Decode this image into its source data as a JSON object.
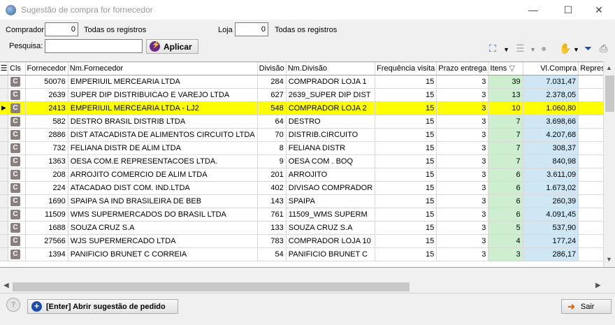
{
  "window": {
    "title": "Sugestão de compra for fornecedor",
    "minimize": "—",
    "maximize": "☐",
    "close": "✕"
  },
  "filters": {
    "comprador_label": "Comprador",
    "comprador_value": "0",
    "comprador_desc": "Todas os registros",
    "loja_label": "Loja",
    "loja_value": "0",
    "loja_desc": "Todas os registros",
    "pesquisa_label": "Pesquisa:",
    "pesquisa_value": "",
    "aplicar_label": "Aplicar"
  },
  "toolbar": {
    "icons": [
      "org-chart-icon",
      "list-icon",
      "disk-icon",
      "dropper-icon",
      "filter-icon",
      "print-icon"
    ]
  },
  "table": {
    "columns": [
      "Cls",
      "Fornecedor",
      "Nm.Fornecedor",
      "Divisão",
      "Nm.Divisão",
      "Frequência visita",
      "Prazo entrega",
      "Itens",
      "Vl.Compra",
      "Represe"
    ],
    "rows": [
      {
        "cls": "C",
        "fornecedor": "50076",
        "nome": "EMPERIUIL MERCEARIA LTDA",
        "divisao": "284",
        "nm_divisao": "COMPRADOR LOJA 1",
        "freq": "15",
        "prazo": "3",
        "itens": "39",
        "valor": "7.031,47",
        "selected": false
      },
      {
        "cls": "C",
        "fornecedor": "2639",
        "nome": "SUPER DIP DISTRIBUICAO E VAREJO LTDA",
        "divisao": "627",
        "nm_divisao": "2639_SUPER DIP DIST",
        "freq": "15",
        "prazo": "3",
        "itens": "13",
        "valor": "2.378,05",
        "selected": false
      },
      {
        "cls": "C",
        "fornecedor": "2413",
        "nome": "EMPERIUIL MERCEARIA LTDA - LJ2",
        "divisao": "548",
        "nm_divisao": "COMPRADOR LOJA 2",
        "freq": "15",
        "prazo": "3",
        "itens": "10",
        "valor": "1.060,80",
        "selected": true
      },
      {
        "cls": "C",
        "fornecedor": "582",
        "nome": "DESTRO BRASIL DISTRIB LTDA",
        "divisao": "64",
        "nm_divisao": "DESTRO",
        "freq": "15",
        "prazo": "3",
        "itens": "7",
        "valor": "3.698,66",
        "selected": false
      },
      {
        "cls": "C",
        "fornecedor": "2886",
        "nome": "DIST ATACADISTA DE ALIMENTOS CIRCUITO LTDA",
        "divisao": "70",
        "nm_divisao": "DISTRIB.CIRCUITO",
        "freq": "15",
        "prazo": "3",
        "itens": "7",
        "valor": "4.207,68",
        "selected": false
      },
      {
        "cls": "C",
        "fornecedor": "732",
        "nome": "FELIANA DISTR DE ALIM LTDA",
        "divisao": "8",
        "nm_divisao": "FELIANA DISTR",
        "freq": "15",
        "prazo": "3",
        "itens": "7",
        "valor": "308,37",
        "selected": false
      },
      {
        "cls": "C",
        "fornecedor": "1363",
        "nome": "OESA COM.E REPRESENTACOES LTDA.",
        "divisao": "9",
        "nm_divisao": "OESA COM . BOQ",
        "freq": "15",
        "prazo": "3",
        "itens": "7",
        "valor": "840,98",
        "selected": false
      },
      {
        "cls": "C",
        "fornecedor": "208",
        "nome": "ARROJITO COMERCIO DE ALIM LTDA",
        "divisao": "201",
        "nm_divisao": "ARROJITO",
        "freq": "15",
        "prazo": "3",
        "itens": "6",
        "valor": "3.611,09",
        "selected": false
      },
      {
        "cls": "C",
        "fornecedor": "224",
        "nome": "ATACADAO DIST COM. IND.LTDA",
        "divisao": "402",
        "nm_divisao": "DIVISAO COMPRADOR",
        "freq": "15",
        "prazo": "3",
        "itens": "6",
        "valor": "1.673,02",
        "selected": false
      },
      {
        "cls": "C",
        "fornecedor": "1690",
        "nome": "SPAIPA SA IND BRASILEIRA DE BEB",
        "divisao": "143",
        "nm_divisao": "SPAIPA",
        "freq": "15",
        "prazo": "3",
        "itens": "6",
        "valor": "260,39",
        "selected": false
      },
      {
        "cls": "C",
        "fornecedor": "11509",
        "nome": "WMS SUPERMERCADOS DO BRASIL LTDA",
        "divisao": "761",
        "nm_divisao": "11509_WMS SUPERM",
        "freq": "15",
        "prazo": "3",
        "itens": "6",
        "valor": "4.091,45",
        "selected": false
      },
      {
        "cls": "C",
        "fornecedor": "1688",
        "nome": "SOUZA CRUZ S.A",
        "divisao": "133",
        "nm_divisao": "SOUZA CRUZ S.A",
        "freq": "15",
        "prazo": "3",
        "itens": "5",
        "valor": "537,90",
        "selected": false
      },
      {
        "cls": "C",
        "fornecedor": "27566",
        "nome": "WJS SUPERMERCADO LTDA",
        "divisao": "783",
        "nm_divisao": "COMPRADOR LOJA 10",
        "freq": "15",
        "prazo": "3",
        "itens": "4",
        "valor": "177,24",
        "selected": false
      },
      {
        "cls": "C",
        "fornecedor": "1394",
        "nome": "PANIFICIO BRUNET C CORREIA",
        "divisao": "54",
        "nm_divisao": "PANIFICIO BRUNET C",
        "freq": "15",
        "prazo": "3",
        "itens": "3",
        "valor": "286,17",
        "selected": false
      }
    ]
  },
  "footer": {
    "help": "?",
    "open_label": "[Enter] Abrir sugestão de pedido",
    "sair_label": "Sair"
  }
}
